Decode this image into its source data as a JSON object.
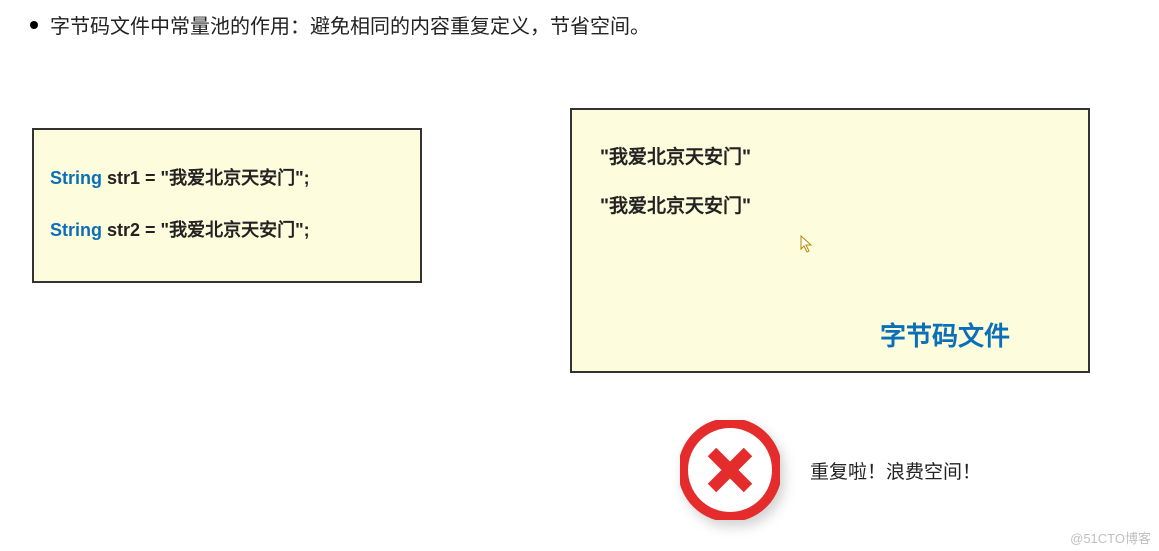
{
  "bullet": {
    "text": "字节码文件中常量池的作用：避免相同的内容重复定义，节省空间。"
  },
  "leftBox": {
    "line1_kw": "String",
    "line1_rest": " str1 = \"我爱北京天安门\";",
    "line2_kw": "String",
    "line2_rest": " str2 = \"我爱北京天安门\";"
  },
  "rightBox": {
    "str1": "\"我爱北京天安门\"",
    "str2": "\"我爱北京天安门\"",
    "label": "字节码文件"
  },
  "error": {
    "text": "重复啦！浪费空间！"
  },
  "watermark": "@51CTO博客"
}
